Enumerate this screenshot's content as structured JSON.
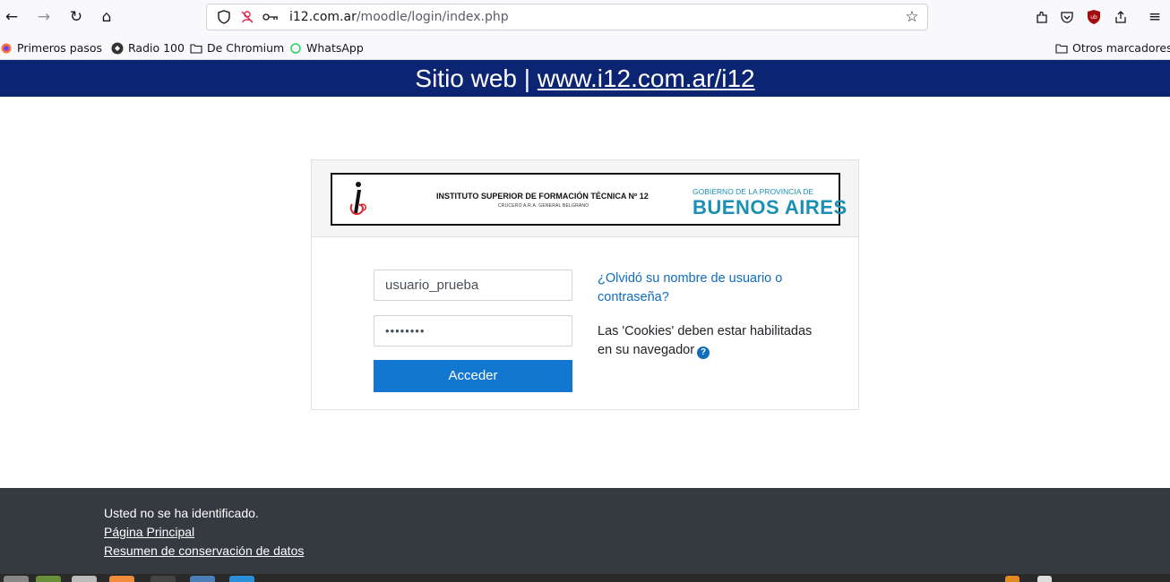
{
  "browser": {
    "url_host": "i12.com.ar",
    "url_path": "/moodle/login/index.php",
    "icons": [
      "back-icon",
      "forward-icon",
      "reload-icon",
      "home-icon",
      "shield-icon",
      "permissions-icon",
      "key-icon",
      "star-icon",
      "extensions-icon",
      "pocket-icon",
      "ublock-icon",
      "share-icon",
      "menu-icon"
    ]
  },
  "bookmarks": {
    "items": [
      {
        "label": "Primeros pasos",
        "icon": "firefox-icon"
      },
      {
        "label": "Radio 100",
        "icon": "radio-icon"
      },
      {
        "label": "De Chromium",
        "icon": "folder-icon"
      },
      {
        "label": "WhatsApp",
        "icon": "whatsapp-icon"
      }
    ],
    "other": "Otros marcadores"
  },
  "banner": {
    "prefix": "Sitio web | ",
    "link": "www.i12.com.ar/i12"
  },
  "logo": {
    "institute": "INSTITUTO SUPERIOR DE FORMACIÓN TÉCNICA Nº 12",
    "subtitle": "CRUCERO A.R.A. GENERAL BELGRANO",
    "government": "GOBIERNO DE LA PROVINCIA DE",
    "province": "BUENOS AIRES"
  },
  "login": {
    "username_value": "usuario_prueba",
    "password_value": "••••••••",
    "submit_label": "Acceder",
    "forgot_link": "¿Olvidó su nombre de usuario o contraseña?",
    "cookies_text": "Las 'Cookies' deben estar habilitadas en su navegador"
  },
  "footer": {
    "not_logged": "Usted no se ha identificado.",
    "home_link": "Página Principal",
    "data_summary_link": "Resumen de conservación de datos"
  },
  "colors": {
    "banner": "#0b2573",
    "primary_button": "#1177d1",
    "link": "#0f6cbf",
    "footer": "#343a40"
  }
}
